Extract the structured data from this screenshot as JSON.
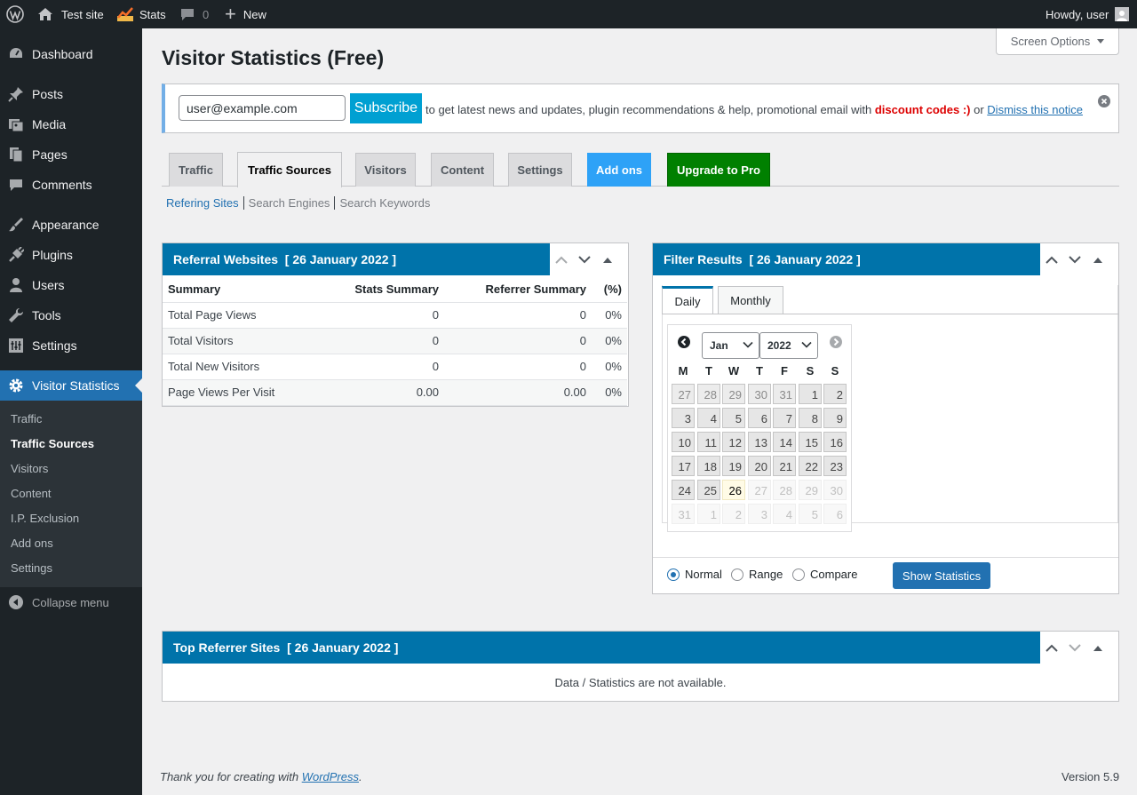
{
  "adminbar": {
    "site_name": "Test site",
    "stats": "Stats",
    "comments_count": "0",
    "new_label": "New",
    "howdy": "Howdy, user"
  },
  "sidebar": {
    "items": [
      {
        "label": "Dashboard",
        "icon": "dashboard-icon"
      },
      {
        "label": "Posts",
        "icon": "pin-icon"
      },
      {
        "label": "Media",
        "icon": "media-icon"
      },
      {
        "label": "Pages",
        "icon": "pages-icon"
      },
      {
        "label": "Comments",
        "icon": "comment-icon"
      },
      {
        "label": "Appearance",
        "icon": "brush-icon"
      },
      {
        "label": "Plugins",
        "icon": "plugin-icon"
      },
      {
        "label": "Users",
        "icon": "user-icon"
      },
      {
        "label": "Tools",
        "icon": "wrench-icon"
      },
      {
        "label": "Settings",
        "icon": "settings-icon"
      },
      {
        "label": "Visitor Statistics",
        "icon": "gear-icon"
      }
    ],
    "submenu": [
      "Traffic",
      "Traffic Sources",
      "Visitors",
      "Content",
      "I.P. Exclusion",
      "Add ons",
      "Settings"
    ],
    "collapse": "Collapse menu"
  },
  "page": {
    "title": "Visitor Statistics (Free)",
    "screen_options": "Screen Options"
  },
  "notice": {
    "email_value": "user@example.com",
    "subscribe": "Subscribe",
    "text": "to get latest news and updates, plugin recommendations & help, promotional email with",
    "discount": "discount codes :)",
    "or": "or",
    "dismiss": "Dismiss this notice"
  },
  "tabs": [
    "Traffic",
    "Traffic Sources",
    "Visitors",
    "Content",
    "Settings",
    "Add ons",
    "Upgrade to Pro"
  ],
  "subtabs": [
    "Refering Sites",
    "Search Engines",
    "Search Keywords"
  ],
  "referral": {
    "title": "Referral Websites  [ 26 January 2022 ]",
    "headers": [
      "Summary",
      "Stats Summary",
      "Referrer Summary",
      "(%)"
    ],
    "rows": [
      [
        "Total Page Views",
        "0",
        "0",
        "0%"
      ],
      [
        "Total Visitors",
        "0",
        "0",
        "0%"
      ],
      [
        "Total New Visitors",
        "0",
        "0",
        "0%"
      ],
      [
        "Page Views Per Visit",
        "0.00",
        "0.00",
        "0%"
      ]
    ]
  },
  "filter": {
    "title": "Filter Results  [ 26 January 2022 ]",
    "tabs": [
      "Daily",
      "Monthly"
    ],
    "month": "Jan",
    "year": "2022",
    "dow": [
      "M",
      "T",
      "W",
      "T",
      "F",
      "S",
      "S"
    ],
    "days": [
      [
        "27",
        "28",
        "29",
        "30",
        "31",
        "1",
        "2"
      ],
      [
        "3",
        "4",
        "5",
        "6",
        "7",
        "8",
        "9"
      ],
      [
        "10",
        "11",
        "12",
        "13",
        "14",
        "15",
        "16"
      ],
      [
        "17",
        "18",
        "19",
        "20",
        "21",
        "22",
        "23"
      ],
      [
        "24",
        "25",
        "26",
        "27",
        "28",
        "29",
        "30"
      ],
      [
        "31",
        "1",
        "2",
        "3",
        "4",
        "5",
        "6"
      ]
    ],
    "radios": [
      "Normal",
      "Range",
      "Compare"
    ],
    "show": "Show Statistics"
  },
  "top_referrer": {
    "title": "Top Referrer Sites  [ 26 January 2022 ]",
    "empty": "Data / Statistics are not available."
  },
  "footer": {
    "thanks": "Thank you for creating with",
    "wp": "WordPress",
    "version": "Version 5.9"
  },
  "colors": {
    "accent": "#2271b1",
    "header_blue": "#0073aa",
    "sidebar_bg": "#1d2327",
    "upgrade_green": "#008000",
    "addons_blue": "#2ea2f7",
    "discount_red": "#dd0000"
  }
}
